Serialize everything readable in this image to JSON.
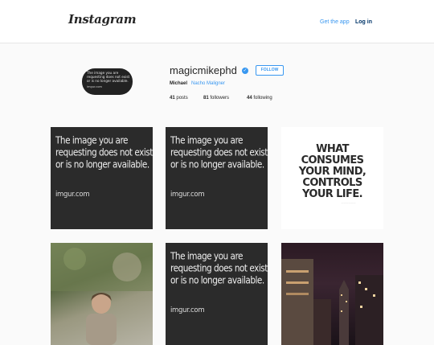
{
  "header": {
    "logo": "Instagram",
    "get_app": "Get the app",
    "login": "Log in"
  },
  "profile": {
    "avatar": {
      "line1": "The image you are",
      "line2": "requesting does not exist",
      "line3": "or is no longer available.",
      "site": "imgur.com"
    },
    "username": "magicmikephd",
    "verified_icon": "verified-badge-icon",
    "follow_label": "FOLLOW",
    "full_name": "Michael",
    "bio_link": "Nacho Maligner",
    "stats": {
      "posts_count": "41",
      "posts_label": "posts",
      "followers_count": "81",
      "followers_label": "followers",
      "following_count": "44",
      "following_label": "following"
    }
  },
  "posts": {
    "unavailable": {
      "line1": "The image you are",
      "line2": "requesting does not exist",
      "line3": "or is no longer available.",
      "site": "imgur.com"
    },
    "quote": {
      "line1": "WHAT",
      "line2": "CONSUMES",
      "line3": "YOUR MIND,",
      "line4": "CONTROLS",
      "line5": "YOUR LIFE."
    }
  },
  "colors": {
    "accent": "#3897f0",
    "login": "#003569",
    "background": "#fafafa",
    "unavailable_tile": "#2b2b2b"
  }
}
